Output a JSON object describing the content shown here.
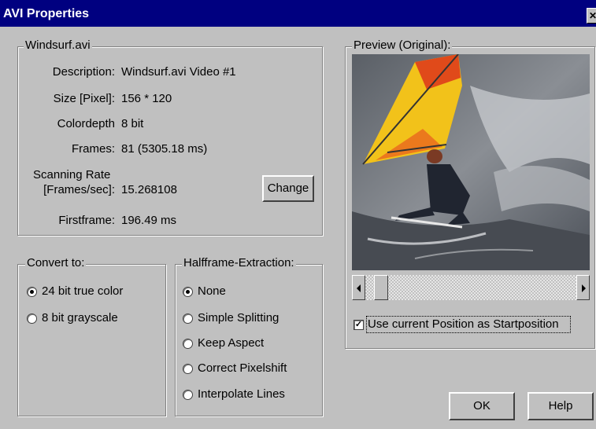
{
  "window": {
    "title": "AVI Properties",
    "close_glyph": "✕"
  },
  "file_group": {
    "legend": "Windsurf.avi",
    "rows": [
      {
        "label": "Description:",
        "value": "Windsurf.avi Video #1"
      },
      {
        "label": "Size [Pixel]:",
        "value": "156 * 120"
      },
      {
        "label": "Colordepth",
        "value": "8 bit"
      },
      {
        "label": "Frames:",
        "value": "81 (5305.18 ms)"
      },
      {
        "label_line1": "Scanning Rate",
        "label_line2": "[Frames/sec]:",
        "value": "15.268108"
      },
      {
        "label": "Firstframe:",
        "value": "196.49 ms"
      }
    ],
    "change_button": "Change"
  },
  "convert_group": {
    "legend": "Convert to:",
    "options": [
      {
        "label": "24 bit true color",
        "selected": true
      },
      {
        "label": "8 bit grayscale",
        "selected": false
      }
    ]
  },
  "halfframe_group": {
    "legend": "Halfframe-Extraction:",
    "options": [
      {
        "label": "None",
        "selected": true
      },
      {
        "label": "Simple Splitting",
        "selected": false
      },
      {
        "label": "Keep Aspect",
        "selected": false
      },
      {
        "label": "Correct Pixelshift",
        "selected": false
      },
      {
        "label": "Interpolate Lines",
        "selected": false
      }
    ]
  },
  "preview_group": {
    "legend": "Preview (Original):",
    "scroll_position": 0.0,
    "use_position_checkbox": {
      "label": "Use current Position as Startposition",
      "checked": true
    }
  },
  "buttons": {
    "ok": "OK",
    "help": "Help"
  },
  "colors": {
    "title_bar": "#000080",
    "face": "#c0c0c0",
    "sail_yellow": "#f2c21a",
    "sail_red": "#e04a1a"
  }
}
